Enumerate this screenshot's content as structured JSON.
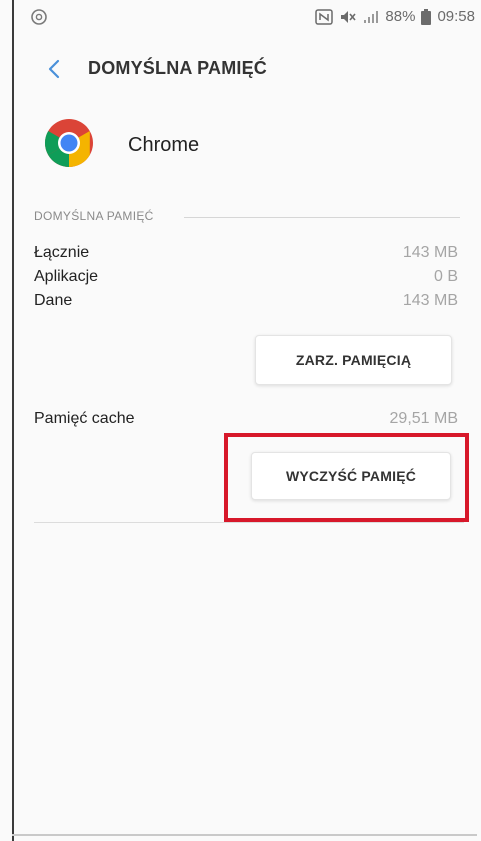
{
  "status_bar": {
    "battery_percent": "88%",
    "time": "09:58"
  },
  "app_bar": {
    "title": "DOMYŚLNA PAMIĘĆ"
  },
  "app": {
    "name": "Chrome"
  },
  "storage": {
    "section_label": "DOMYŚLNA PAMIĘĆ",
    "rows": [
      {
        "label": "Łącznie",
        "value": "143 MB"
      },
      {
        "label": "Aplikacje",
        "value": "0 B"
      },
      {
        "label": "Dane",
        "value": "143 MB"
      }
    ],
    "manage_button": "ZARZ. PAMIĘCIĄ"
  },
  "cache": {
    "label": "Pamięć cache",
    "value": "29,51 MB",
    "clear_button": "WYCZYŚĆ PAMIĘĆ"
  },
  "colors": {
    "highlight": "#d7182a",
    "back_arrow": "#4a90d9"
  }
}
